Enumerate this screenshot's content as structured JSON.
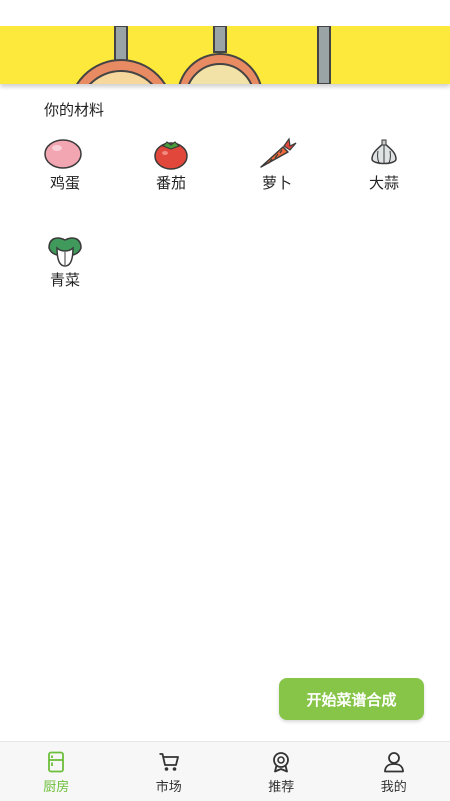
{
  "section": {
    "title": "你的材料"
  },
  "ingredients": [
    {
      "name": "鸡蛋",
      "icon": "egg-icon"
    },
    {
      "name": "番茄",
      "icon": "tomato-icon"
    },
    {
      "name": "萝卜",
      "icon": "carrot-icon"
    },
    {
      "name": "大蒜",
      "icon": "garlic-icon"
    },
    {
      "name": "青菜",
      "icon": "bok-choy-icon"
    }
  ],
  "action": {
    "start_label": "开始菜谱合成"
  },
  "tabs": [
    {
      "label": "厨房",
      "icon": "fridge-icon",
      "active": true
    },
    {
      "label": "市场",
      "icon": "cart-icon",
      "active": false
    },
    {
      "label": "推荐",
      "icon": "badge-icon",
      "active": false
    },
    {
      "label": "我的",
      "icon": "user-icon",
      "active": false
    }
  ],
  "colors": {
    "accent": "#86c548",
    "active_tab": "#6cbf3a",
    "banner": "#fde93b"
  }
}
